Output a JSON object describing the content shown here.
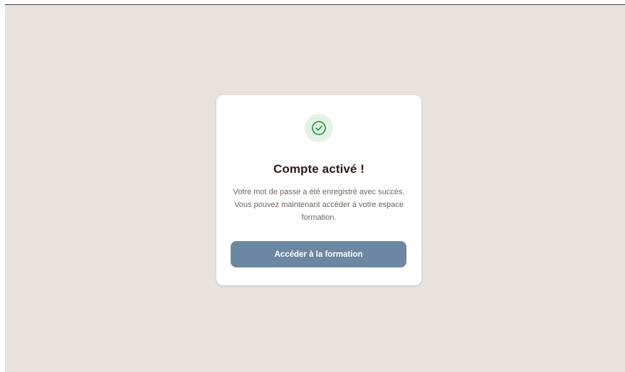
{
  "dialog": {
    "icon": "check-circle-icon",
    "title": "Compte activé !",
    "message": "Votre mot de passe a été enregistré avec succès. Vous pouvez maintenant accéder à votre espace formation.",
    "button_label": "Accéder à la formation"
  },
  "colors": {
    "page_background": "#e7e2de",
    "card_background": "#ffffff",
    "success_green": "#2e9e4f",
    "success_tint": "#e4f2e6",
    "button_background": "#6b87a1",
    "title_text": "#2b1a16"
  }
}
